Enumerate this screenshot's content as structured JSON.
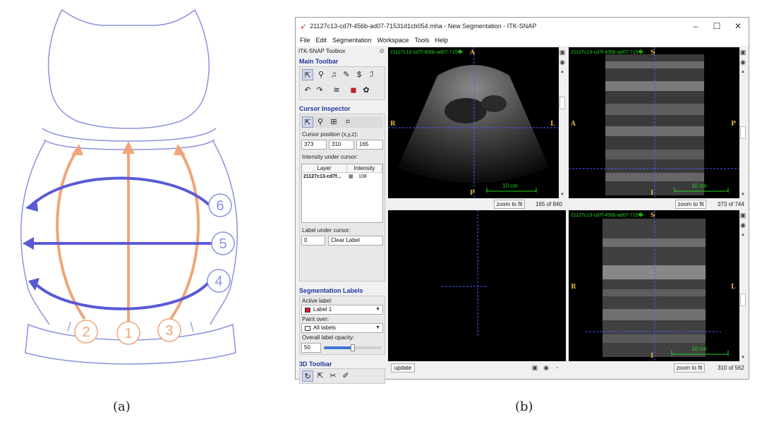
{
  "panel_a": {
    "markers": [
      "6",
      "5",
      "4",
      "2",
      "1",
      "3"
    ],
    "caption": "(a)",
    "colors": {
      "outline": "#8b92e0",
      "arrow_blue": "#5a5ad6",
      "arrow_orange": "#f0a57a"
    }
  },
  "panel_b": {
    "caption": "(b)",
    "window_title": "21127c13-cd7f-456b-ad07-71531d1cb054.mha - New Segmentation - ITK-SNAP",
    "menu": [
      "File",
      "Edit",
      "Segmentation",
      "Workspace",
      "Tools",
      "Help"
    ],
    "toolbox": {
      "title": "ITK-SNAP Toolbox",
      "main_toolbar": "Main Toolbar",
      "cursor_inspector": "Cursor Inspector",
      "cursor_position_label": "Cursor position (x,y,z):",
      "cursor_x": "373",
      "cursor_y": "310",
      "cursor_z": "165",
      "intensity_label": "Intensity under cursor:",
      "table_header_layer": "Layer",
      "table_header_intensity": "Intensity",
      "table_row_layer": "21127c13-cd7f...",
      "table_row_intensity": "108",
      "label_under_cursor_label": "Label under cursor:",
      "label_under_cursor_value": "0",
      "label_under_cursor_name": "Clear Label",
      "segmentation_labels": "Segmentation Labels",
      "active_label_label": "Active label:",
      "active_label_value": "Label 1",
      "paint_over_label": "Paint over:",
      "paint_over_value": "All labels",
      "opacity_label": "Overall label opacity:",
      "opacity_value": "50",
      "toolbar_3d": "3D Toolbar"
    },
    "views": {
      "axial": {
        "label": "21127c13-cd7f-456b-ad07-715�",
        "top": "A",
        "bottom": "P",
        "left": "R",
        "right": "L",
        "scale": "10 cm",
        "zoom": "zoom to fit",
        "slice": "165 of 840"
      },
      "sagittal": {
        "label": "21127c13-cd7f-456b-ad07-715�",
        "top": "S",
        "bottom": "I",
        "left": "A",
        "right": "P",
        "scale": "10 cm",
        "zoom": "zoom to fit",
        "slice": "373 of 744"
      },
      "render3d": {
        "update": "update"
      },
      "coronal": {
        "label": "21127c13-cd7f-456b-ad07-715�",
        "top": "S",
        "bottom": "I",
        "left": "R",
        "right": "L",
        "scale": "10 cm",
        "zoom": "zoom to fit",
        "slice": "310 of 562"
      }
    },
    "colors": {
      "overlay_green": "#22d322",
      "orient_gold": "#e0b23a",
      "crosshair": "#4b5cff",
      "section_title": "#24379b",
      "active_label": "#d0202a"
    }
  }
}
